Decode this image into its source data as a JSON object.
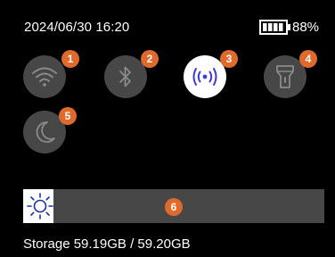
{
  "status": {
    "datetime": "2024/06/30 16:20",
    "battery_percent_label": "88%",
    "battery_level": 0.88,
    "battery_icon": "battery-icon"
  },
  "tiles": [
    {
      "name": "wifi",
      "icon": "wifi-icon",
      "active": false,
      "badge": "1"
    },
    {
      "name": "bluetooth",
      "icon": "bluetooth-icon",
      "active": false,
      "badge": "2"
    },
    {
      "name": "hotspot",
      "icon": "hotspot-icon",
      "active": true,
      "badge": "3"
    },
    {
      "name": "flashlight",
      "icon": "flashlight-icon",
      "active": false,
      "badge": "4"
    },
    {
      "name": "night-mode",
      "icon": "moon-icon",
      "active": false,
      "badge": "5"
    }
  ],
  "brightness": {
    "icon": "sun-icon",
    "level": 0.1,
    "badge": "6"
  },
  "storage": {
    "label": "Storage 59.19GB / 59.20GB"
  },
  "colors": {
    "background": "#000000",
    "tile_inactive": "#474747",
    "tile_active": "#ffffff",
    "active_icon": "#3b3bd9",
    "badge": "#e06a2c"
  }
}
